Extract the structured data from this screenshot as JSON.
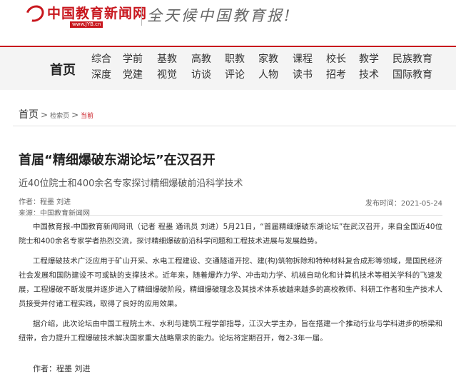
{
  "header": {
    "logo_text": "中国教育新闻网",
    "logo_url": "www.JYB.cn",
    "slogan": "全天候中国教育报!"
  },
  "nav": {
    "home": "首页",
    "items": [
      "综合",
      "学前",
      "基教",
      "高教",
      "职教",
      "家教",
      "课程",
      "校长",
      "教学",
      "民族教育",
      "深度",
      "党建",
      "视觉",
      "访谈",
      "评论",
      "人物",
      "读书",
      "招考",
      "技术",
      "国际教育"
    ]
  },
  "breadcrumb": {
    "home": "首页",
    "separator": ">",
    "level2": "检索页",
    "current": "当前"
  },
  "article": {
    "title": "首届“精细爆破东湖论坛”在汉召开",
    "subtitle": "近40位院士和400余名专家探讨精细爆破前沿科学技术",
    "author_line": "作者：程墨 刘进",
    "source_line": "来源：中国教育新闻网",
    "date_line": "发布时间：2021-05-24",
    "paragraphs": [
      "中国教育报-中国教育新闻网讯（记者 程墨 通讯员 刘进）5月21日，“首届精细爆破东湖论坛”在武汉召开，来自全国近40位院士和400余名专家学者热烈交流，探讨精细爆破前沿科学问题和工程技术进展与发展趋势。",
      "工程爆破技术广泛应用于矿山开采、水电工程建设、交通隧道开挖、建(构)筑物拆除和特种材料复合成形等领域，是国民经济社会发展和国防建设不可或缺的支撑技术。近年来，随着爆炸力学、冲击动力学、机械自动化和计算机技术等相关学科的飞速发展，工程爆破不断发展并逐步进入了精细爆破阶段，精细爆破理念及其技术体系被越来越多的高校教师、科研工作者和生产技术人员接受并付诸工程实践，取得了良好的应用效果。",
      "据介绍，此次论坛由中国工程院土木、水利与建筑工程学部指导，江汉大学主办，旨在搭建一个推动行业与学科进步的桥梁和纽带，合力提升工程爆破技术解决国家重大战略需求的能力。论坛将定期召开，每2-3年一届。"
    ],
    "footer_author": "作者：程墨 刘进"
  },
  "colors": {
    "brand_red": "#c8161d",
    "nav_bg": "#f4f4f4"
  }
}
